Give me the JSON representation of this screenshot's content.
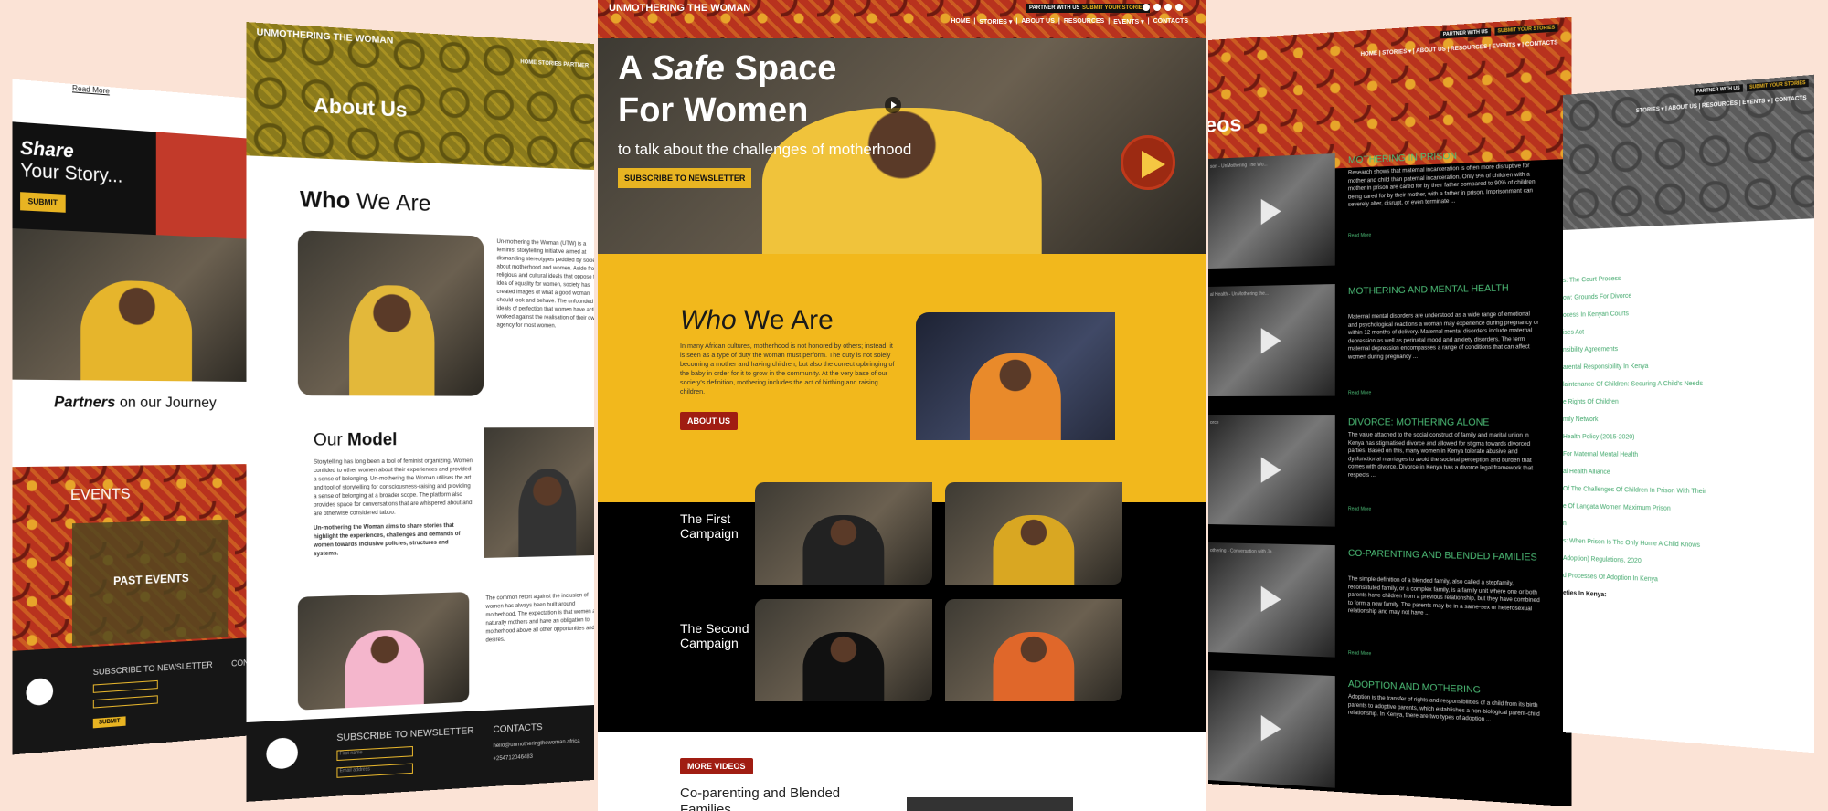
{
  "left_share_page": {
    "read_more": "Read More",
    "share_title": "Share",
    "share_subtitle": "Your Story...",
    "submit_label": "SUBMIT",
    "partners_bold": "Partners",
    "partners_rest": "on our Journey",
    "events_label": "EVENTS",
    "past_events_label": "PAST EVENTS",
    "subscribe_label": "SUBSCRIBE TO NEWSLETTER",
    "contact_label": "CONTA",
    "subscribe_button": "SUBMIT"
  },
  "about_page": {
    "brand": "UNMOTHERING THE WOMAN",
    "nav_text": "HOME  STORIES  PARTNER",
    "hero_title": "About Us",
    "who_bold": "Who",
    "who_rest": "We Are",
    "who_text": "Un-mothering the Woman (UTW) is a feminist storytelling initiative aimed at dismantling stereotypes peddled by society about motherhood and women. Aside from religious and cultural ideals that oppose the idea of equality for women, society has created images of what a good woman should look and behave. The unfounded ideals of perfection that women have actively worked against the realisation of their own agency for most women.",
    "model_light": "Our",
    "model_bold": "Model",
    "model_text": "Storytelling has long been a tool of feminist organizing. Women confided to other women about their experiences and provided a sense of belonging. Un-mothering the Woman utilises the art and tool of storytelling for consciousness-raising and providing a sense of belonging at a broader scope. The platform also provides space for conversations that are whispered about and are otherwise considered taboo.",
    "model_text_bold": "Un-mothering the Woman aims to share stories that highlight the experiences, challenges and demands of women towards inclusive policies, structures and systems.",
    "third_text": "The common retort against the inclusion of women has always been built around motherhood. The expectation is that women are naturally mothers and have an obligation to motherhood above all other opportunities and desires.",
    "subscribe_label": "SUBSCRIBE TO NEWSLETTER",
    "first_name_ph": "First name",
    "email_ph": "Email address",
    "contact_label": "CONTACTS",
    "contact_email": "hello@unmotheringthewoman.africa",
    "contact_phone": "+254712046483"
  },
  "home_page": {
    "brand": "UNMOTHERING THE WOMAN",
    "partner_label": "PARTNER WITH US",
    "submit_stories_label": "SUBMIT YOUR STORIES",
    "nav": [
      "HOME",
      "|",
      "STORIES ▾",
      "|",
      "ABOUT US",
      "|",
      "RESOURCES",
      "|",
      "EVENTS ▾",
      "|",
      "CONTACTS"
    ],
    "hero_line1_a": "A",
    "hero_line1_italic": "Safe",
    "hero_line1_b": "Space",
    "hero_line2": "For Women",
    "hero_subtitle": "to talk about the challenges of motherhood",
    "newsletter_button": "SUBSCRIBE TO NEWSLETTER",
    "who_italic": "Who",
    "who_rest": "We Are",
    "who_text": "In many African cultures, motherhood is not honored by others; instead, it is seen as a type of duty the woman must perform. The duty is not solely becoming a mother and having children, but also the correct upbringing of the baby in order for it to grow in the community. At the very base of our society's definition, mothering includes the act of birthing and raising children.",
    "about_button": "ABOUT US",
    "first_campaign": "The First Campaign",
    "second_campaign": "The Second Campaign",
    "more_videos_button": "MORE VIDEOS",
    "featured_title": "Co-parenting and Blended Families"
  },
  "videos_page": {
    "hero_title": "eos",
    "partner_label": "PARTNER WITH US",
    "submit_label": "SUBMIT YOUR STORIES",
    "nav_text": "HOME | STORIES ▾ | ABOUT US | RESOURCES | EVENTS ▾ | CONTACTS",
    "read_more": "Read More",
    "items": [
      {
        "caption": "son - UnMothering The Wo...",
        "title": "MOTHERING IN PRISON",
        "text": "Research shows that maternal incarceration is often more disruptive for mother and child than paternal incarceration. Only 9% of children with a mother in prison are cared for by their father compared to 90% of children being cared for by their mother, with a father in prison. Imprisonment can severely alter, disrupt, or even terminate ..."
      },
      {
        "caption": "al Health - UnMothering the...",
        "title": "MOTHERING AND MENTAL HEALTH",
        "text": "Maternal mental disorders are understood as a wide range of emotional and psychological reactions a woman may experience during pregnancy or within 12 months of delivery. Maternal mental disorders include maternal depression as well as perinatal mood and anxiety disorders. The term maternal depression encompasses a range of conditions that can affect women during pregnancy ..."
      },
      {
        "caption": "orce",
        "title": "DIVORCE: MOTHERING ALONE",
        "text": "The value attached to the social construct of family and marital union in Kenya has stigmatised divorce and allowed for stigma towards divorced parties. Based on this, many women in Kenya tolerate abusive and dysfunctional marriages to avoid the societal perception and burden that comes with divorce. Divorce in Kenya has a divorce legal framework that respects ..."
      },
      {
        "caption": "othering - Conversation with Ja...",
        "title": "CO-PARENTING AND BLENDED FAMILIES",
        "text": "The simple definition of a blended family, also called a stepfamily, reconstituted family, or a complex family, is a family unit where one or both parents have children from a previous relationship, but they have combined to form a new family. The parents may be in a same-sex or heterosexual relationship and may not have ..."
      },
      {
        "caption": "",
        "title": "ADOPTION AND MOTHERING",
        "text": "Adoption is the transfer of rights and responsibilities of a child from its birth parents to adoptive parents, which establishes a non-biological parent-child relationship. In Kenya, there are two types of adoption ..."
      }
    ]
  },
  "resources_page": {
    "partner_label": "PARTNER WITH US",
    "submit_label": "SUBMIT YOUR STORIES",
    "nav_text": "STORIES ▾ | ABOUT US | RESOURCES | EVENTS ▾ | CONTACTS",
    "links": [
      "s: The Court Process",
      "ow: Grounds For Divorce",
      "ocess In Kenyan Courts",
      "ises Act",
      "nsibility Agreements",
      "arental Responsibility In Kenya",
      "laintenance Of Children: Securing A Child's Needs",
      "e Rights Of Children",
      "mily Network",
      "Health Policy (2015-2020)",
      "For Maternal Mental Health",
      "al Health Alliance",
      "Of The Challenges Of Children In Prison With Their",
      "e Of Langata Women Maximum Prison",
      "n",
      "s: When Prison Is The Only Home A Child Knows",
      "Adoption) Regulations, 2020",
      "d Processes Of Adoption In Kenya",
      "eties In Kenya:"
    ]
  }
}
